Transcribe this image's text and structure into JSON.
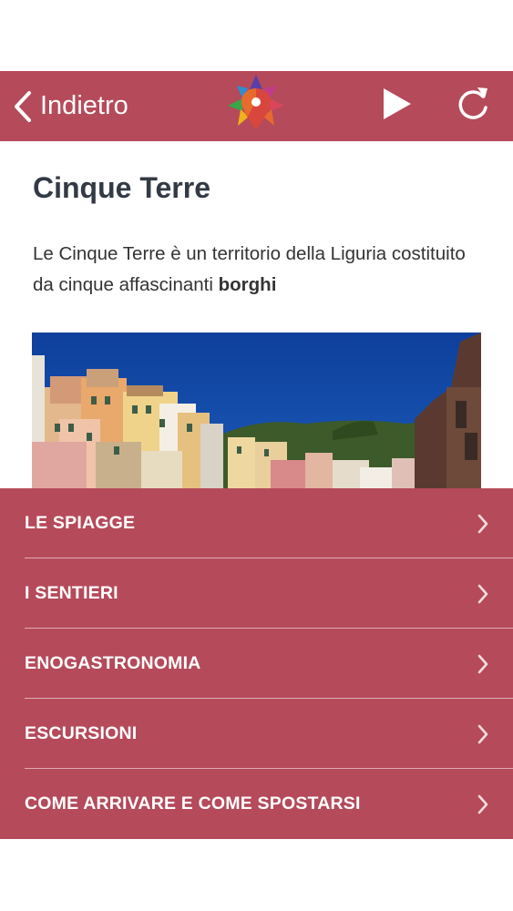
{
  "colors": {
    "accent": "#b54a5a",
    "text": "#333a44"
  },
  "navbar": {
    "back_label": "Indietro",
    "icons": [
      "chevron-left-icon",
      "app-logo-icon",
      "play-icon",
      "reload-icon"
    ]
  },
  "page": {
    "title": "Cinque Terre",
    "description_lead": "Le Cinque Terre è un territorio della Liguria costituito da cinque affascinanti ",
    "description_bold": "borghi"
  },
  "menu": {
    "items": [
      {
        "label": "LE SPIAGGE"
      },
      {
        "label": "I SENTIERI"
      },
      {
        "label": "ENOGASTRONOMIA"
      },
      {
        "label": "ESCURSIONI"
      },
      {
        "label": "COME ARRIVARE E COME SPOSTARSI"
      }
    ]
  }
}
